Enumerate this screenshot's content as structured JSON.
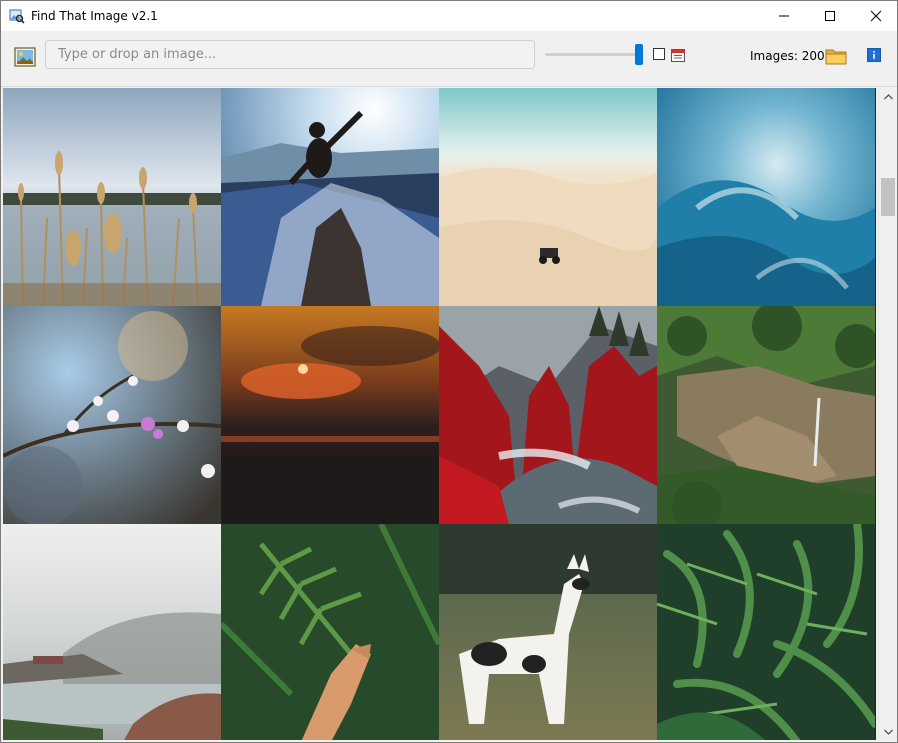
{
  "window": {
    "title": "Find That Image v2.1",
    "icons": {
      "app": "image-search-icon",
      "minimize": "minimize-icon",
      "maximize": "maximize-icon",
      "close": "close-icon"
    }
  },
  "toolbar": {
    "image_button_icon": "picture-icon",
    "search": {
      "value": "",
      "placeholder": "Type or drop an image..."
    },
    "thumbnail_size_slider": {
      "value": 1.0
    },
    "checkbox_checked": false,
    "calendar_icon": "calendar-icon",
    "images_count_label": "Images: 200",
    "folder_icon": "folder-icon",
    "info_icon": "info-icon",
    "accent_color": "#0078d7"
  },
  "gallery": {
    "tiles": [
      {
        "subject": "lake-reeds",
        "row": 0,
        "col": 0
      },
      {
        "subject": "mountain-summit-person",
        "row": 0,
        "col": 1
      },
      {
        "subject": "desert-dunes-car",
        "row": 0,
        "col": 2
      },
      {
        "subject": "ocean-wave",
        "row": 0,
        "col": 3
      },
      {
        "subject": "blossom-branch",
        "row": 1,
        "col": 0
      },
      {
        "subject": "sunset-beach",
        "row": 1,
        "col": 1
      },
      {
        "subject": "red-forest-river",
        "row": 1,
        "col": 2
      },
      {
        "subject": "canyon-waterfall",
        "row": 1,
        "col": 3
      },
      {
        "subject": "misty-lake-village",
        "row": 2,
        "col": 0
      },
      {
        "subject": "hand-fern",
        "row": 2,
        "col": 1
      },
      {
        "subject": "llama-field",
        "row": 2,
        "col": 2
      },
      {
        "subject": "palm-leaves",
        "row": 2,
        "col": 3
      }
    ]
  },
  "scrollbar": {
    "up_icon": "scroll-up-arrow-icon",
    "down_icon": "scroll-down-arrow-icon"
  }
}
